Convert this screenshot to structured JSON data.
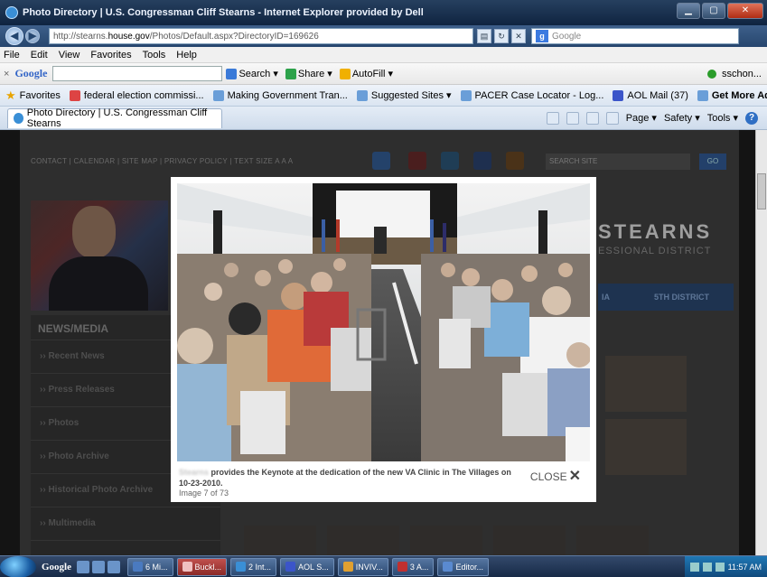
{
  "window": {
    "title": "Photo Directory | U.S. Congressman [redacted] - Internet Explorer provided by Dell",
    "title_visible": "Photo Directory | U.S. Congressman Cliff Stearns - Internet Explorer provided by Dell"
  },
  "address": {
    "url_prefix": "http://stearns.",
    "url_host": "house.gov",
    "url_path": "/Photos/Default.aspx?DirectoryID=169626",
    "search_placeholder": "Google"
  },
  "menu": [
    "File",
    "Edit",
    "View",
    "Favorites",
    "Tools",
    "Help"
  ],
  "google_toolbar": {
    "close": "×",
    "logo": "Google",
    "buttons": [
      "Search",
      "Share",
      "AutoFill"
    ],
    "user": "sschon..."
  },
  "favorites": {
    "label": "Favorites",
    "items": [
      "federal election commissi...",
      "Making Government Tran...",
      "Suggested Sites ▾",
      "PACER Case Locator - Log...",
      "AOL Mail (37)",
      "Get More Add-ons ▾"
    ]
  },
  "tab": {
    "label": "Photo Directory | U.S. Congressman Cliff Stearns"
  },
  "commands": [
    "Page ▾",
    "Safety ▾",
    "Tools ▾"
  ],
  "site": {
    "top_links": "CONTACT  |  CALENDAR  |  SITE MAP  |  PRIVACY POLICY  |  TEXT SIZE   A  A  A",
    "search_placeholder": "SEARCH SITE",
    "go_label": "GO",
    "banner_title": "STEARNS",
    "banner_sub": "ESSIONAL DISTRICT",
    "nav": [
      "IA",
      "5TH DISTRICT"
    ],
    "news_head": "NEWS/MEDIA",
    "news_items": [
      "Recent News",
      "Press Releases",
      "Photos",
      "Photo Archive",
      "Historical Photo Archive",
      "Multimedia"
    ]
  },
  "lightbox": {
    "caption_name": "Stearns",
    "caption_text": " provides the Keynote at the dedication of the new VA Clinic in The Villages on 10-23-2010.",
    "counter": "Image 7 of 73",
    "close_label": "CLOSE",
    "close_glyph": "✕"
  },
  "taskbar": {
    "google": "Google",
    "tasks": [
      "6 Mi...",
      "Buckl...",
      "2 Int...",
      "AOL S...",
      "INVIV...",
      "3 A...",
      "Editor..."
    ],
    "clock": "11:57 AM"
  },
  "colors": {
    "titlebar": "#0f2440",
    "overlay_bg": "#141414",
    "lightbox_bg": "#ffffff",
    "taskbar": "#172a47"
  }
}
